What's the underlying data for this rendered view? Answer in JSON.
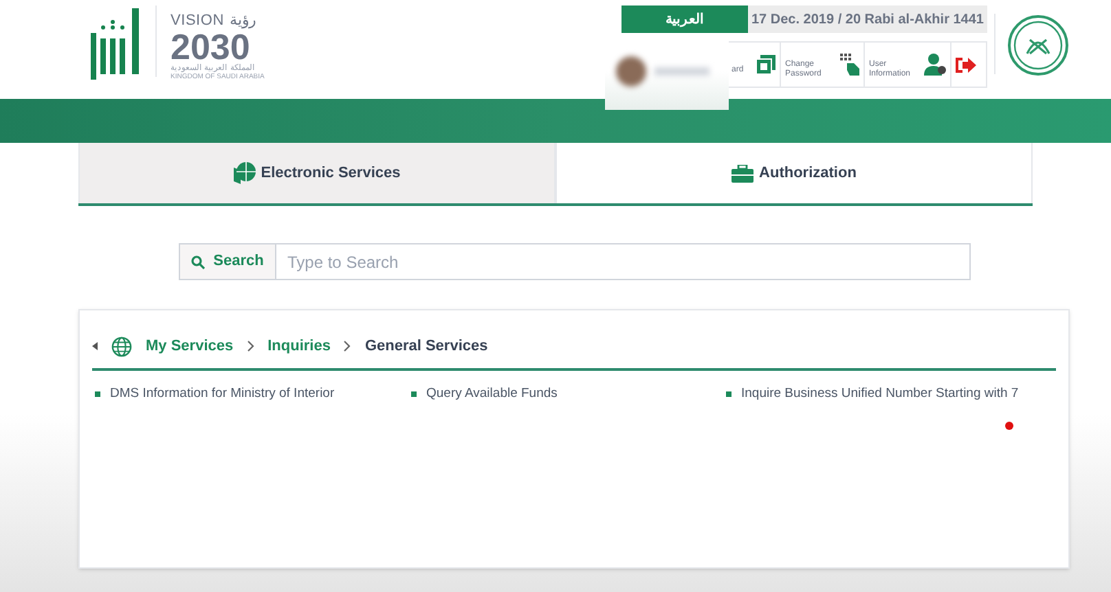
{
  "header": {
    "language_button": "العربية",
    "date": "17 Dec. 2019 / 20 Rabi al-Akhir 1441",
    "toolbar": [
      {
        "kind": "dashboard",
        "label": "ard"
      },
      {
        "kind": "password",
        "label": "Change Password"
      },
      {
        "kind": "user",
        "label": "User Information"
      },
      {
        "kind": "logout"
      }
    ]
  },
  "vision_logo": {
    "vision": "VISION",
    "vision_ar": "رؤية",
    "year": "2030",
    "kingdom_ar": "المملكة العربية السعودية",
    "kingdom": "KINGDOM OF SAUDI ARABIA"
  },
  "tabs": [
    {
      "kind": "services",
      "label": "Electronic Services",
      "selected": true
    },
    {
      "kind": "authorization",
      "label": "Authorization",
      "selected": false
    }
  ],
  "search": {
    "button": "Search",
    "placeholder": "Type to Search"
  },
  "breadcrumb": [
    {
      "label": "My Services",
      "current": false
    },
    {
      "label": "Inquiries",
      "current": false
    },
    {
      "label": "General Services",
      "current": true
    }
  ],
  "services": [
    "DMS Information for Ministry of Interior",
    "Query Available Funds",
    "Inquire Business Unified Number Starting with 7"
  ]
}
